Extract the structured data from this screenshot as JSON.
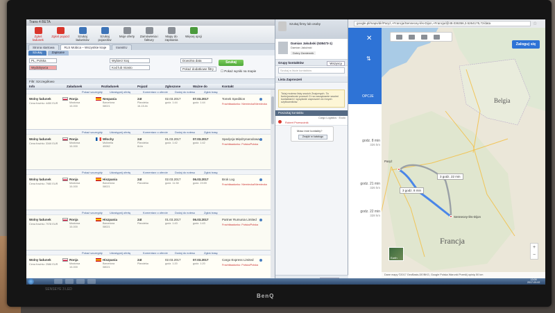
{
  "app": {
    "title": "Trans 4 BETA",
    "ribbon": [
      {
        "label": "Zgłoś ładunek",
        "tone": "red"
      },
      {
        "label": "Zgłoś pojazd",
        "tone": "red"
      },
      {
        "label": "Szukaj ładunków",
        "tone": "blue"
      },
      {
        "label": "Szukaj pojazdów",
        "tone": "blue"
      },
      {
        "label": "Moje oferty",
        "tone": "gray"
      },
      {
        "label": "Zamówienia i faktury",
        "tone": "gray"
      },
      {
        "label": "Mapy do zapisania",
        "tone": "gray"
      },
      {
        "label": "Więcej opcji",
        "tone": "green"
      }
    ],
    "tabs": [
      "Strona startowa",
      "RLS Mobica – Wszystkie kraje",
      "transEU"
    ],
    "subtabs": [
      "Szukaj",
      "Zapisane"
    ],
    "filters": {
      "from_country": "PL, Polska",
      "from_city": "Wydobywca",
      "to_region": "Wybierz kraj",
      "to_city": "Kod lub miasto",
      "date": "Dowolna data",
      "extra": "Pokaż dodatkowe filtry",
      "search_button": "Szukaj",
      "checkbox": "Pokaż wyniki na mapie"
    },
    "filter_bar": "Filtr: Szczegółowo",
    "columns": [
      "Info",
      "Załadunek",
      "Rozładunek",
      "Pojazd",
      "Zgłoszone",
      "Ważne do",
      "Kontakt"
    ],
    "offers": [
      {
        "title": "Wolny ładunek",
        "price": "Cena frachtu: 4450 EUR",
        "from": "Ronja",
        "from_sub": "Mostowa",
        "from_code": "10-000",
        "to": "Nespania",
        "to_sub": "Barcelona",
        "to_code": "08021",
        "vehicle": "24t",
        "vehicle_sub": "Plandeka",
        "vehicle_extra": "16-15-lin",
        "posted": "02.03.2017",
        "posted_time": "godz. 1:44",
        "valid": "07.03.2017",
        "valid_time": "godz. 1:44",
        "contact": "Tomek Spedition",
        "note": "Frachtłaadunku: Niemiecka/Niemiecka",
        "bar": [
          "Pokaż szczegóły",
          "Udostępnij ofertę",
          "Komentarz o ofercie",
          "Dodaj do notesu",
          "Zgłoś trasę"
        ],
        "fromflag": "pl",
        "toflag": "es"
      },
      {
        "title": "Wolny ładunek",
        "price": "Cena frachtu: 3349 EUR",
        "from": "Ronja",
        "from_sub": "Mostowa",
        "from_code": "10-000",
        "to": "Włochy",
        "to_sub": "Molinella",
        "to_code": "40062",
        "vehicle": "24t",
        "vehicle_sub": "Plandeka",
        "vehicle_extra": "6t-lin",
        "posted": "01.03.2017",
        "posted_time": "godz. 1:42",
        "valid": "07.03.2017",
        "valid_time": "godz. 1:42",
        "contact": "Spedycja Międzynarodowa",
        "note": "Frachtłaadunku: Polska/Polska",
        "bar": [
          "Pokaż szczegóły",
          "Udostępnij ofertę",
          "Komentarz o ofercie",
          "Dodaj do notesu",
          "Zgłoś trasę"
        ],
        "fromflag": "pl",
        "toflag": "fr"
      },
      {
        "title": "Wolny ładunek",
        "price": "Cena frachtu: 7980 EUR",
        "from": "Ronja",
        "from_sub": "Mostowa",
        "from_code": "10-000",
        "to": "Hiszpania",
        "to_sub": "Barcelona",
        "to_code": "08021",
        "vehicle": "24t",
        "vehicle_sub": "Plandeka",
        "vehicle_extra": "",
        "posted": "02.03.2017",
        "posted_time": "godz. 11:38",
        "valid": "06.03.2017",
        "valid_time": "godz. 23:59",
        "contact": "Brok Log",
        "note": "Frachtłaadunku: Niemiecka/Niemiecka",
        "bar": [
          "Pokaż szczegóły",
          "Udostępnij ofertę",
          "Komentarz o ofercie",
          "Dodaj do notesu",
          "Zgłoś trasę"
        ],
        "fromflag": "pl",
        "toflag": "es"
      },
      {
        "title": "Wolny ładunek",
        "price": "Cena frachtu: 7978 EUR",
        "from": "Ronja",
        "from_sub": "Mostowa",
        "from_code": "10-000",
        "to": "Hiszpania",
        "to_sub": "Barcelona",
        "to_code": "08021",
        "vehicle": "24t",
        "vehicle_sub": "Plandeka",
        "vehicle_extra": "",
        "posted": "01.03.2017",
        "posted_time": "godz. 1:43",
        "valid": "06.03.2017",
        "valid_time": "godz. 1:43",
        "contact": "Partner Rumunia Limited",
        "note": "Frachtłaadunku: Polska/Polska",
        "bar": [
          "Pokaż szczegóły",
          "Udostępnij ofertę",
          "Komentarz o ofercie",
          "Dodaj do notesu",
          "Zgłoś trasę"
        ],
        "fromflag": "pl",
        "toflag": "es"
      },
      {
        "title": "Wolny ładunek",
        "price": "Cena frachtu: 2586 EUR",
        "from": "Ronja",
        "from_sub": "Mostowa",
        "from_code": "10-000",
        "to": "Hiszpania",
        "to_sub": "Barcelona",
        "to_code": "08021",
        "vehicle": "24t",
        "vehicle_sub": "Plandeka",
        "vehicle_extra": "",
        "posted": "02.03.2017",
        "posted_time": "godz. 1:20",
        "valid": "07.03.2017",
        "valid_time": "godz. 1:20",
        "contact": "Cargo Express Limited",
        "note": "Frachtłaadunku: Polska/Polska",
        "bar": [
          "Pokaż szczegóły",
          "Udostępnij ofertę",
          "Komentarz o ofercie",
          "Dodaj do notesu",
          "Zgłoś trasę"
        ],
        "fromflag": "pl",
        "toflag": "es"
      }
    ]
  },
  "messenger": {
    "top_label": "Szukaj firmy lub osoby",
    "user_name": "Damian Jakubski (538473-1)",
    "user_sub": "Damian Jakubski",
    "user_status": "Dobry Zamiennik",
    "groups_label": "Grupy kontaktów",
    "groups_filter": "Wszyscy",
    "search_placeholder": "Szukaj w liście kontaktów",
    "list_label": "Lista Zaproszeń",
    "hint": "Tutaj możesz listę swoich Znajomych. Ta funkcjonalność pozwoli Ci na zarządzanie swoimi kontaktami i wysyłanie zaproszeń do innych użytkowników.",
    "section_label": "Poszukaj kontaktu",
    "item_company": "Cargo Logistics",
    "item_state": "Ecolo",
    "item_person": "Robert Przewoźnik",
    "ask_question": "Masz inne kontakty?",
    "ask_button": "Znajdź w katalogu",
    "footer_left": "Ilość kontaktów: 1/8 otw.",
    "footer_right": "Szczegółowo"
  },
  "browser": {
    "url": "google.pl/maps/dir/Paryż,+Francja/Sennecey-lès-Dijon,+Francja/@48.036356,3.5264175,7z/data",
    "login": "Zaloguj się",
    "opcje": "OPCJE",
    "routes": [
      {
        "time": "godz. 8 min",
        "km": "326 km"
      },
      {
        "time": "godz. 21 min",
        "km": "326 km"
      },
      {
        "time": "godz. 22 min",
        "km": "328 km"
      }
    ],
    "countries": [
      "Belgia",
      "Francja"
    ],
    "cities": [
      "Paryż",
      "Sennecey-lès-Dijon"
    ],
    "boxes": [
      "3 godz. 8 min",
      "3 godz. 22 min"
    ],
    "earth": "Earth",
    "footer": "Dane mapy ©2017 GeoBasis-DE/BKG, Google   Polska   Warunki   Prześlij opinię   50 km"
  },
  "taskbar": {
    "time": "13:09",
    "date": "2017-03-02"
  },
  "monitor": {
    "brand": "BenQ",
    "bezel": "SENSEYE 3 LED"
  }
}
